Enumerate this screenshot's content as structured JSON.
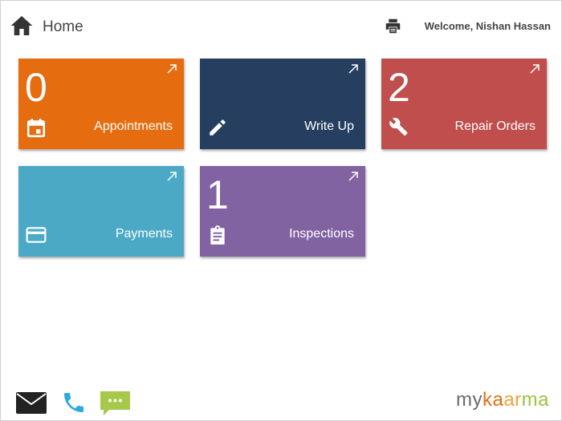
{
  "header": {
    "home_label": "Home",
    "welcome_text": "Welcome, Nishan Hassan"
  },
  "tiles": [
    {
      "id": "appointments",
      "label": "Appointments",
      "count": "0",
      "icon": "calendar-icon",
      "color": "#e56c0f"
    },
    {
      "id": "writeup",
      "label": "Write Up",
      "count": "",
      "icon": "pencil-icon",
      "color": "#263f60"
    },
    {
      "id": "repair",
      "label": "Repair Orders",
      "count": "2",
      "icon": "wrench-icon",
      "color": "#bf4e4c"
    },
    {
      "id": "payments",
      "label": "Payments",
      "count": "",
      "icon": "credit-card-icon",
      "color": "#4ba9c5"
    },
    {
      "id": "inspections",
      "label": "Inspections",
      "count": "1",
      "icon": "clipboard-icon",
      "color": "#8263a2"
    }
  ],
  "footer": {
    "icons": [
      "mail-icon",
      "phone-icon",
      "chat-icon"
    ],
    "logo": {
      "part1": "my",
      "part2": "ka",
      "part3": "ar",
      "part4": "ma"
    }
  },
  "colors": {
    "chat": "#a6c94a",
    "phone": "#2fa9dc",
    "mail": "#222222"
  }
}
